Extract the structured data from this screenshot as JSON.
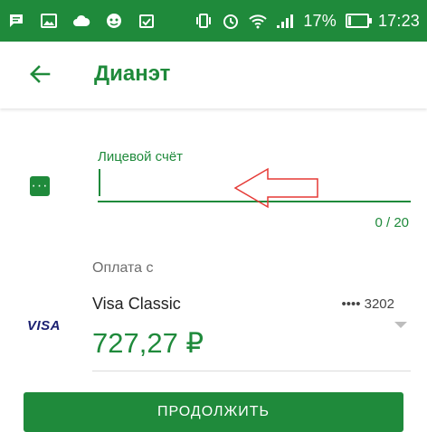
{
  "status_bar": {
    "battery_percent": "17%",
    "battery_level": 0.17,
    "time": "17:23"
  },
  "app_bar": {
    "title": "Дианэт"
  },
  "form": {
    "account_label": "Лицевой счёт",
    "account_value": "",
    "counter": "0 / 20"
  },
  "payment": {
    "label": "Оплата с",
    "card_logo": "VISA",
    "card_name": "Visa Classic",
    "card_mask": "•••• 3202",
    "balance": "727,27 ₽"
  },
  "continue_label": "ПРОДОЛЖИТЬ",
  "colors": {
    "accent": "#1f8a3b",
    "annotation_arrow": "#e53935"
  }
}
